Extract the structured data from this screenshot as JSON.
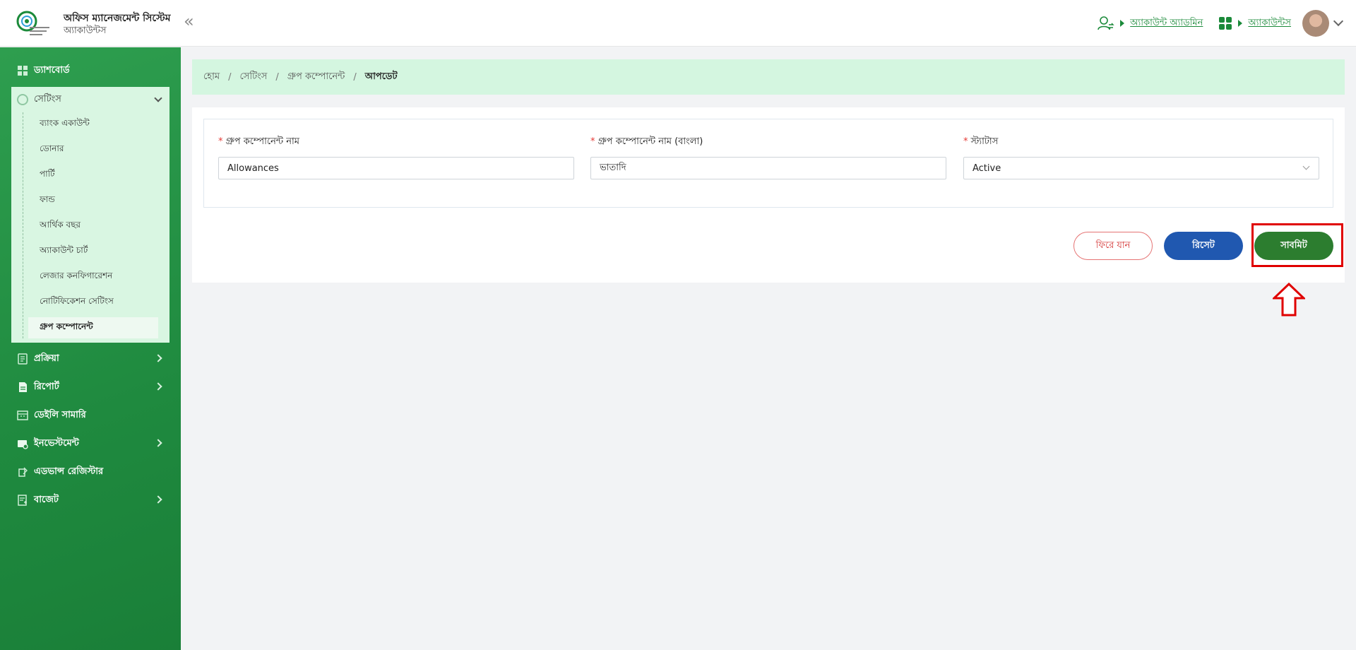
{
  "header": {
    "app_title": "অফিস ম্যানেজমেন্ট সিস্টেম",
    "app_subtitle": "অ্যাকাউন্টস",
    "admin_link": "অ্যাকাউন্ট অ্যাডমিন",
    "accounts_link": "অ্যাকাউন্টস"
  },
  "sidebar": {
    "dashboard": "ড্যাশবোর্ড",
    "settings": "সেটিংস",
    "settings_items": [
      "ব্যাংক একাউন্ট",
      "ডোনার",
      "পার্টি",
      "ফান্ড",
      "আর্থিক বছর",
      "অ্যাকাউন্ট চার্ট",
      "লেজার কনফিগারেশন",
      "নোটিফিকেশন সেটিংস",
      "গ্রুপ কম্পোনেন্ট"
    ],
    "process": "প্রক্রিয়া",
    "report": "রিপোর্ট",
    "daily_summary": "ডেইলি সামারি",
    "investment": "ইনভেস্টমেন্ট",
    "advance_register": "এডভান্স রেজিস্টার",
    "budget": "বাজেট"
  },
  "breadcrumb": {
    "home": "হোম",
    "settings": "সেটিংস",
    "group_component": "গ্রুপ কম্পোনেন্ট",
    "current": "আপডেট"
  },
  "form": {
    "name_label": "গ্রুপ কম্পোনেন্ট নাম",
    "name_value": "Allowances",
    "name_bn_label": "গ্রুপ কম্পোনেন্ট নাম (বাংলা)",
    "name_bn_value": "ভাতাদি",
    "status_label": "স্ট্যাটাস",
    "status_value": "Active",
    "required_mark": "*"
  },
  "buttons": {
    "back": "ফিরে যান",
    "reset": "রিসেট",
    "submit": "সাবমিট"
  },
  "colors": {
    "brand_green": "#1f8a3f",
    "submit_green": "#2c7d2f",
    "reset_blue": "#2058b0",
    "highlight_red": "#e00000"
  }
}
